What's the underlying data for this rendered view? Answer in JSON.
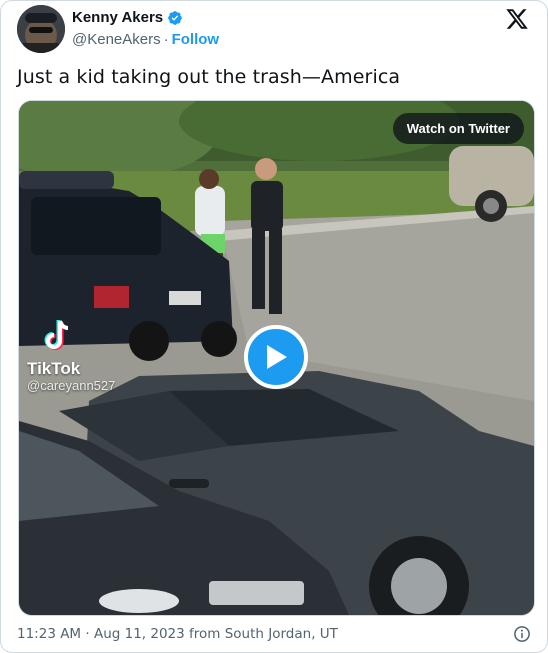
{
  "author": {
    "display_name": "Kenny Akers",
    "handle": "@KeneAkers",
    "separator": "·",
    "follow_label": "Follow"
  },
  "tweet": {
    "text": "Just a kid taking out the trash—America"
  },
  "media": {
    "watch_label": "Watch on Twitter",
    "watermark_brand": "TikTok",
    "watermark_user": "@careyann527"
  },
  "meta": {
    "timestamp": "11:23 AM · Aug 11, 2023 from South Jordan, UT"
  },
  "icons": {
    "verified": "verified-badge-icon",
    "x_logo": "x-logo-icon",
    "play": "play-icon",
    "info": "info-icon",
    "tiktok": "tiktok-icon"
  },
  "colors": {
    "accent": "#1d9bf0",
    "text_primary": "#0f1419",
    "text_secondary": "#536471",
    "border": "#cfd9de"
  }
}
